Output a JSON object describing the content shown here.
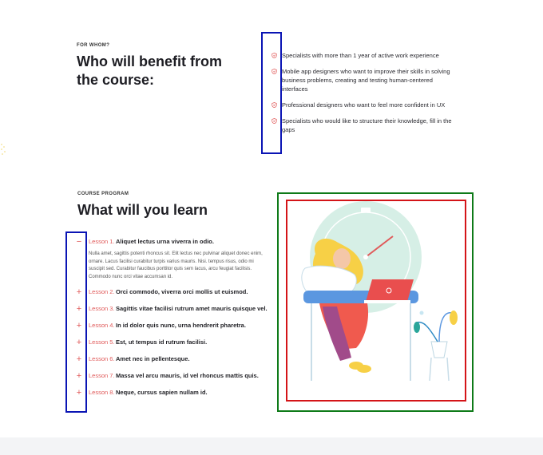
{
  "for_whom": {
    "eyebrow": "FOR WHOM?",
    "heading_line1": "Who will benefit from",
    "heading_line2": "the course:",
    "items": [
      {
        "icon": "shield-check-icon",
        "text": "Specialists with more than 1 year of active work experience"
      },
      {
        "icon": "shield-check-icon",
        "text": "Mobile app designers who want to improve their skills in solving business problems, creating and testing human-centered interfaces"
      },
      {
        "icon": "shield-check-icon",
        "text": "Professional designers who want to feel more confident in UX"
      },
      {
        "icon": "shield-check-icon",
        "text": "Specialists who would like to structure their knowledge, fill in the gaps"
      }
    ]
  },
  "program": {
    "eyebrow": "COURSE PROGRAM",
    "heading": "What will you learn",
    "lessons": [
      {
        "num": "Lesson 1.",
        "title": "Aliquet lectus urna viverra in odio.",
        "toggle": "−",
        "open": true,
        "desc": "Nulla amet, sagittis potenti rhoncus sit. Elit lectus nec pulvinar aliquet donec enim, ornare. Lacus facilisi curabitur turpis varius mauris. Nisi. tempus risus, odio mi suscipit sed. Curabitur faucibus porttitor quis sem lacus, arcu feugiat facilisis. Commodo nunc orci vitae accumsan id."
      },
      {
        "num": "Lesson 2.",
        "title": "Orci commodo, viverra orci mollis ut euismod.",
        "toggle": "+"
      },
      {
        "num": "Lesson 3.",
        "title": "Sagittis vitae facilisi rutrum amet mauris quisque vel.",
        "toggle": "+"
      },
      {
        "num": "Lesson 4.",
        "title": "In id dolor quis nunc, urna hendrerit pharetra.",
        "toggle": "+"
      },
      {
        "num": "Lesson 5.",
        "title": "Est, ut tempus id rutrum facilisi.",
        "toggle": "+"
      },
      {
        "num": "Lesson 6.",
        "title": "Amet nec in pellentesque.",
        "toggle": "+"
      },
      {
        "num": "Lesson 7.",
        "title": "Massa vel arcu mauris, id vel rhoncus mattis quis.",
        "toggle": "+"
      },
      {
        "num": "Lesson 8.",
        "title": "Neque, cursus sapien nullam id.",
        "toggle": "+"
      }
    ]
  },
  "colors": {
    "accent": "#e05a5a",
    "annotation_blue": "#0a14b4",
    "annotation_red": "#d41418",
    "annotation_green": "#0e7a18"
  }
}
